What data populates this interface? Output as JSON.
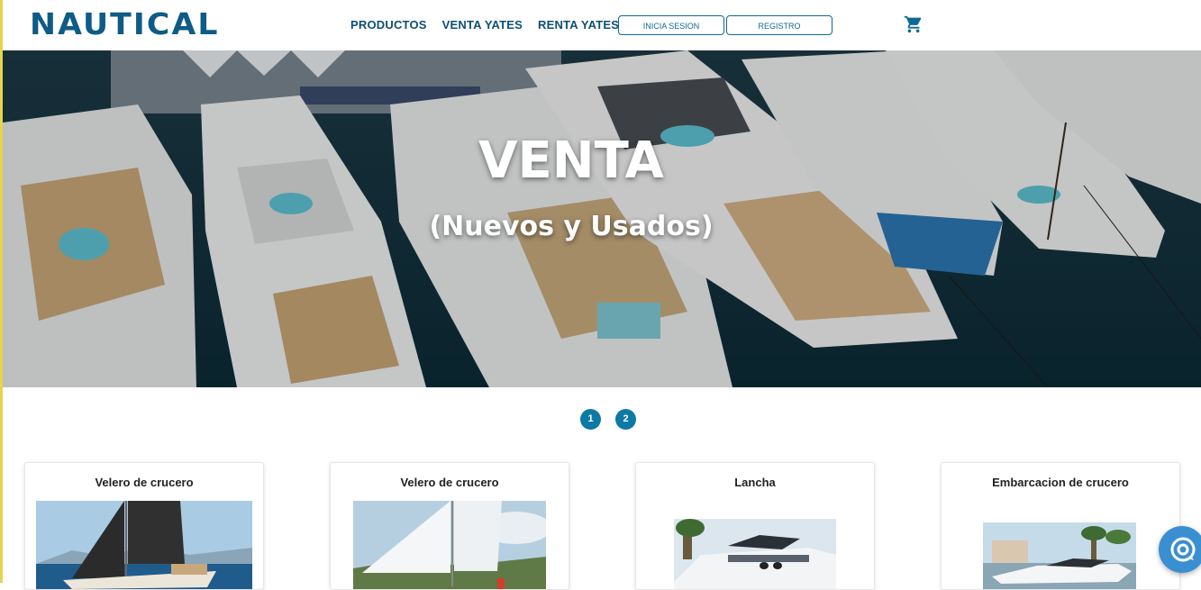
{
  "brand": {
    "logo_text": "NAUTICAL",
    "color": "#0e5b86"
  },
  "nav": {
    "items": [
      "PRODUCTOS",
      "VENTA YATES",
      "RENTA YATES"
    ],
    "login_label": "INICIA SESION",
    "register_label": "REGISTRO"
  },
  "hero": {
    "title": "VENTA",
    "subtitle": "(Nuevos y Usados)"
  },
  "pagination": {
    "pages": [
      "1",
      "2"
    ]
  },
  "cards": [
    {
      "title": "Velero de crucero"
    },
    {
      "title": "Velero de crucero"
    },
    {
      "title": "Lancha"
    },
    {
      "title": "Embarcacion de crucero"
    }
  ],
  "icons": {
    "cart": "cart-icon",
    "chat": "chat-icon"
  },
  "colors": {
    "accent": "#0d7aa6",
    "nav_text": "#0e4f75",
    "chat": "#3a8fd0"
  }
}
